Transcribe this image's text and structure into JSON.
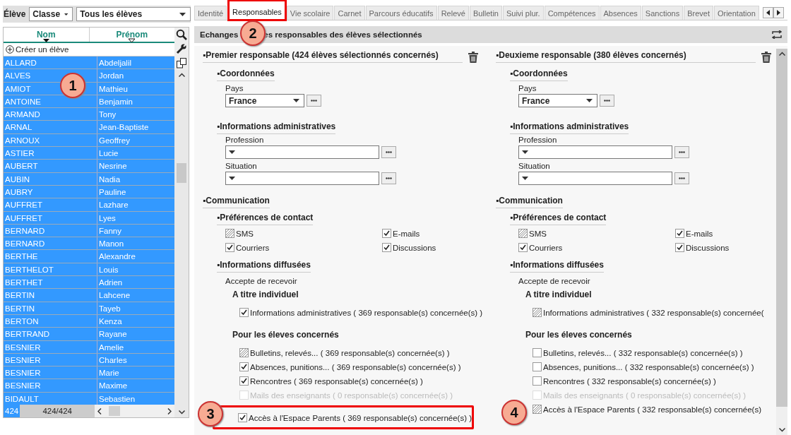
{
  "student_panel": {
    "label": "Élève",
    "filter_dropdown": "Classe",
    "scope_dropdown": "Tous les élèves",
    "columns": [
      {
        "label": "Nom",
        "sorted": true
      },
      {
        "label": "Prénom",
        "sorted": false
      }
    ],
    "create_label": "Créer un élève",
    "rows": [
      {
        "nom": "ALLARD",
        "prenom": "Abdeljalil",
        "selected": true
      },
      {
        "nom": "ALVES",
        "prenom": "Jordan",
        "selected": true
      },
      {
        "nom": "AMIOT",
        "prenom": "Mathieu",
        "selected": true
      },
      {
        "nom": "ANTOINE",
        "prenom": "Benjamin",
        "selected": true
      },
      {
        "nom": "ARMAND",
        "prenom": "Tony",
        "selected": true
      },
      {
        "nom": "ARNAL",
        "prenom": "Jean-Baptiste",
        "selected": true
      },
      {
        "nom": "ARNOUX",
        "prenom": "Geoffrey",
        "selected": true
      },
      {
        "nom": "ASTIER",
        "prenom": "Lucie",
        "selected": true
      },
      {
        "nom": "AUBERT",
        "prenom": "Nesrine",
        "selected": true
      },
      {
        "nom": "AUBIN",
        "prenom": "Nadia",
        "selected": true
      },
      {
        "nom": "AUBRY",
        "prenom": "Pauline",
        "selected": true
      },
      {
        "nom": "AUFFRET",
        "prenom": "Lazhare",
        "selected": true
      },
      {
        "nom": "AUFFRET",
        "prenom": "Lyes",
        "selected": true
      },
      {
        "nom": "BERNARD",
        "prenom": "Fanny",
        "selected": true
      },
      {
        "nom": "BERNARD",
        "prenom": "Manon",
        "selected": true
      },
      {
        "nom": "BERTHE",
        "prenom": "Alexandre",
        "selected": true
      },
      {
        "nom": "BERTHELOT",
        "prenom": "Louis",
        "selected": true
      },
      {
        "nom": "BERTHET",
        "prenom": "Adrien",
        "selected": true
      },
      {
        "nom": "BERTIN",
        "prenom": "Lahcene",
        "selected": true
      },
      {
        "nom": "BERTIN",
        "prenom": "Tayeb",
        "selected": true
      },
      {
        "nom": "BERTON",
        "prenom": "Kenza",
        "selected": true
      },
      {
        "nom": "BERTRAND",
        "prenom": "Rayane",
        "selected": true
      },
      {
        "nom": "BESNIER",
        "prenom": "Amelie",
        "selected": true
      },
      {
        "nom": "BESNIER",
        "prenom": "Charles",
        "selected": true
      },
      {
        "nom": "BESNIER",
        "prenom": "Marie",
        "selected": true
      },
      {
        "nom": "BESNIER",
        "prenom": "Maxime",
        "selected": true
      },
      {
        "nom": "BIDAULT",
        "prenom": "Sebastien",
        "selected": true
      }
    ],
    "selected_count": "424",
    "total": "424/424"
  },
  "tabs": [
    {
      "label": "Identité",
      "selected": false,
      "highlighted": false
    },
    {
      "label": "Responsables",
      "selected": true,
      "highlighted": true
    },
    {
      "label": "Vie scolaire",
      "selected": false,
      "highlighted": false
    },
    {
      "label": "Carnet",
      "selected": false,
      "highlighted": false
    },
    {
      "label": "Parcours éducatifs",
      "selected": false,
      "highlighted": false
    },
    {
      "label": "Relevé",
      "selected": false,
      "highlighted": false
    },
    {
      "label": "Bulletin",
      "selected": false,
      "highlighted": false
    },
    {
      "label": "Suivi plur.",
      "selected": false,
      "highlighted": false
    },
    {
      "label": "Compétences",
      "selected": false,
      "highlighted": false
    },
    {
      "label": "Absences",
      "selected": false,
      "highlighted": false
    },
    {
      "label": "Sanctions",
      "selected": false,
      "highlighted": false
    },
    {
      "label": "Brevet",
      "selected": false,
      "highlighted": false
    },
    {
      "label": "Orientation",
      "selected": false,
      "highlighted": false
    }
  ],
  "panel": {
    "title_start": "Echanges",
    "title_end": "es responsables des élèves sélectionnés",
    "columns": [
      {
        "heading": "▪Premier responsable (424 élèves sélectionnés concernés)",
        "coordonnees": {
          "heading": "▪Coordonnées",
          "pays_label": "Pays",
          "pays_value": "France"
        },
        "admin": {
          "heading": "▪Informations administratives",
          "profession_label": "Profession",
          "situation_label": "Situation"
        },
        "communication": {
          "heading": "▪Communication",
          "prefs_heading": "▪Préférences de contact",
          "prefs": [
            {
              "label": "SMS",
              "checked": false,
              "mixed": true
            },
            {
              "label": "E-mails",
              "checked": true,
              "mixed": false
            },
            {
              "label": "Courriers",
              "checked": true,
              "mixed": false
            },
            {
              "label": "Discussions",
              "checked": true,
              "mixed": false
            }
          ],
          "info_heading": "▪Informations diffusées",
          "accept_label": "Accepte de recevoir",
          "individual_heading": "A titre individuel",
          "individual": [
            {
              "label": "Informations administratives ( 369 responsable(s) concernée(s) )",
              "checked": true,
              "mixed": false
            }
          ],
          "students_heading": "Pour les éleves concernés",
          "students": [
            {
              "label": "Bulletins, relevés... ( 369 responsable(s) concernée(s) )",
              "checked": false,
              "mixed": true,
              "disabled": false,
              "highlighted": false
            },
            {
              "label": "Absences, punitions... ( 369 responsable(s) concernée(s) )",
              "checked": true,
              "mixed": false,
              "disabled": false,
              "highlighted": false
            },
            {
              "label": "Rencontres ( 369 responsable(s) concernée(s) )",
              "checked": true,
              "mixed": false,
              "disabled": false,
              "highlighted": false
            },
            {
              "label": "Mails des enseignants ( 0 responsable(s) concernée(s) )",
              "checked": false,
              "mixed": false,
              "disabled": true,
              "highlighted": false
            },
            {
              "label": "Accès à l'Espace Parents ( 369 responsable(s) concernée(s) )",
              "checked": true,
              "mixed": false,
              "disabled": false,
              "highlighted": true
            }
          ]
        }
      },
      {
        "heading": "▪Deuxieme responsable (380 élèves concernés)",
        "coordonnees": {
          "heading": "▪Coordonnées",
          "pays_label": "Pays",
          "pays_value": "France"
        },
        "admin": {
          "heading": "▪Informations administratives",
          "profession_label": "Profession",
          "situation_label": "Situation"
        },
        "communication": {
          "heading": "▪Communication",
          "prefs_heading": "▪Préférences de contact",
          "prefs": [
            {
              "label": "SMS",
              "checked": false,
              "mixed": true
            },
            {
              "label": "E-mails",
              "checked": true,
              "mixed": false
            },
            {
              "label": "Courriers",
              "checked": true,
              "mixed": false
            },
            {
              "label": "Discussions",
              "checked": true,
              "mixed": false
            }
          ],
          "info_heading": "▪Informations diffusées",
          "accept_label": "Accepte de recevoir",
          "individual_heading": "A titre individuel",
          "individual": [
            {
              "label": "Informations administratives ( 332 responsable(s) concernée(",
              "checked": false,
              "mixed": true
            }
          ],
          "students_heading": "Pour les éleves concernés",
          "students": [
            {
              "label": "Bulletins, relevés... ( 332 responsable(s) concernée(s) )",
              "checked": false,
              "mixed": false,
              "disabled": false,
              "highlighted": false
            },
            {
              "label": "Absences, punitions... ( 332 responsable(s) concernée(s) )",
              "checked": false,
              "mixed": false,
              "disabled": false,
              "highlighted": false
            },
            {
              "label": "Rencontres ( 332 responsable(s) concernée(s) )",
              "checked": false,
              "mixed": false,
              "disabled": false,
              "highlighted": false
            },
            {
              "label": "Mails des enseignants ( 0 responsable(s) concernée(s) )",
              "checked": false,
              "mixed": false,
              "disabled": true,
              "highlighted": false
            },
            {
              "label": "Accès à l'Espace Parents ( 332 responsable(s) concernée(s)",
              "checked": false,
              "mixed": true,
              "disabled": false,
              "highlighted": false
            }
          ]
        }
      }
    ]
  },
  "callouts": [
    {
      "label": "1"
    },
    {
      "label": "2"
    },
    {
      "label": "3"
    },
    {
      "label": "4"
    }
  ]
}
